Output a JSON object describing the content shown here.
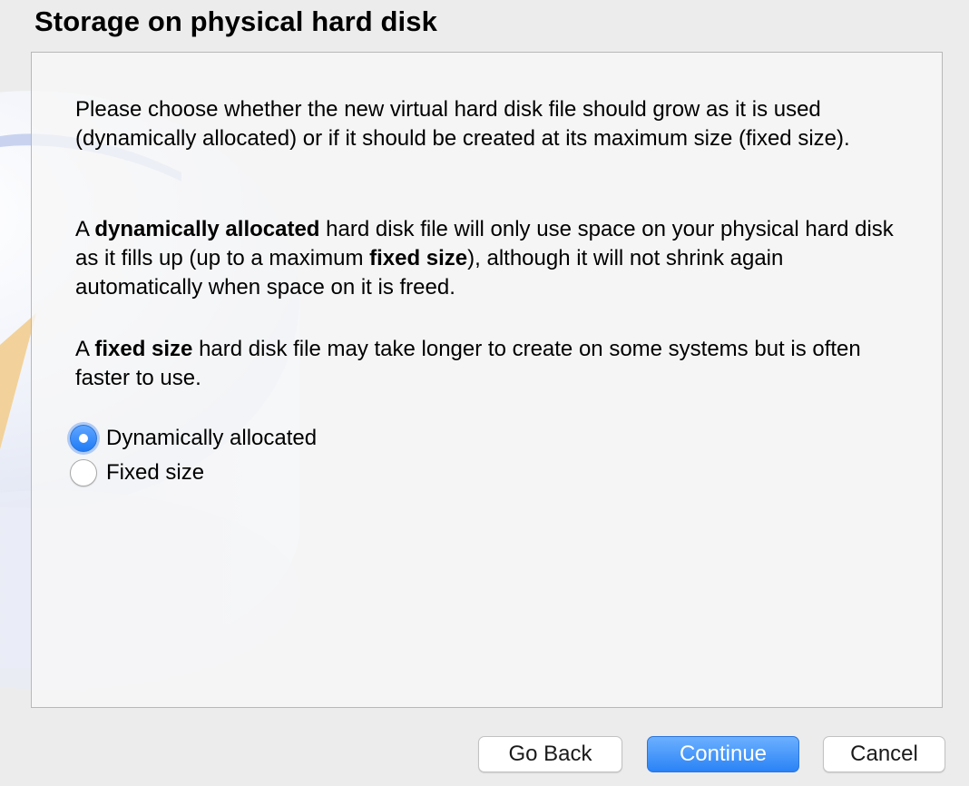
{
  "page_title": "Storage on physical hard disk",
  "description": {
    "p1": "Please choose whether the new virtual hard disk file should grow as it is used (dynamically allocated) or if it should be created at its maximum size (fixed size).",
    "p2_a": "A ",
    "p2_b": "dynamically allocated",
    "p2_c": " hard disk file will only use space on your physical hard disk as it fills up (up to a maximum ",
    "p2_d": "fixed size",
    "p2_e": "), although it will not shrink again automatically when space on it is freed.",
    "p3_a": "A ",
    "p3_b": "fixed size",
    "p3_c": " hard disk file may take longer to create on some systems but is often faster to use."
  },
  "options": [
    {
      "label": "Dynamically allocated",
      "selected": true
    },
    {
      "label": "Fixed size",
      "selected": false
    }
  ],
  "buttons": {
    "go_back": "Go Back",
    "continue": "Continue",
    "cancel": "Cancel"
  },
  "colors": {
    "accent": "#2a83f6",
    "background": "#ececec"
  }
}
